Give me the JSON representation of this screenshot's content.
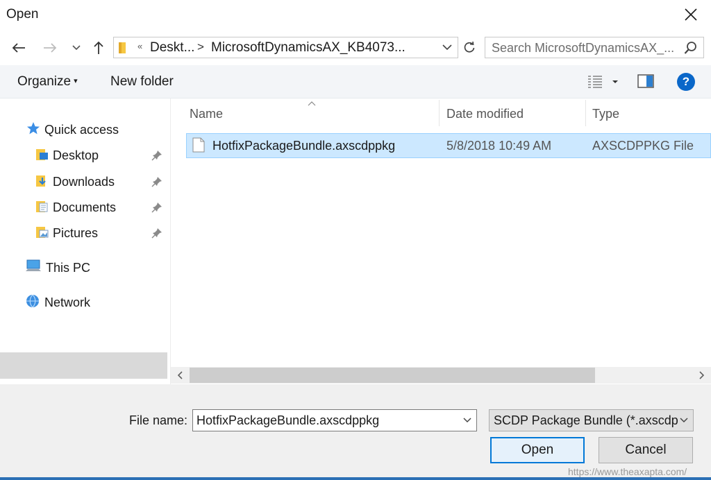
{
  "window": {
    "title": "Open"
  },
  "address": {
    "overflow_glyph": "«",
    "crumbs": [
      "Deskt...",
      "MicrosoftDynamicsAX_KB4073..."
    ],
    "separator": ">"
  },
  "search": {
    "placeholder": "Search MicrosoftDynamicsAX_..."
  },
  "toolbar": {
    "organize": "Organize",
    "organize_caret": "▾",
    "new_folder": "New folder",
    "help": "?"
  },
  "navpane": {
    "quick_access": "Quick access",
    "items": [
      {
        "label": "Desktop",
        "icon": "desktop-folder-icon",
        "pinned": true
      },
      {
        "label": "Downloads",
        "icon": "downloads-folder-icon",
        "pinned": true
      },
      {
        "label": "Documents",
        "icon": "documents-folder-icon",
        "pinned": true
      },
      {
        "label": "Pictures",
        "icon": "pictures-folder-icon",
        "pinned": true
      }
    ],
    "this_pc": "This PC",
    "network": "Network"
  },
  "columns": {
    "name": "Name",
    "date": "Date modified",
    "type": "Type"
  },
  "files": [
    {
      "name": "HotfixPackageBundle.axscdppkg",
      "date": "5/8/2018 10:49 AM",
      "type": "AXSCDPPKG File",
      "selected": true
    }
  ],
  "footer": {
    "file_name_label": "File name:",
    "file_name_value": "HotfixPackageBundle.axscdppkg",
    "file_type": "SCDP Package Bundle (*.axscdp",
    "open": "Open",
    "cancel": "Cancel"
  },
  "watermark": "https://www.theaxapta.com/",
  "colors": {
    "selection": "#cce8ff",
    "accent": "#0078d7",
    "help": "#0a67c9"
  }
}
